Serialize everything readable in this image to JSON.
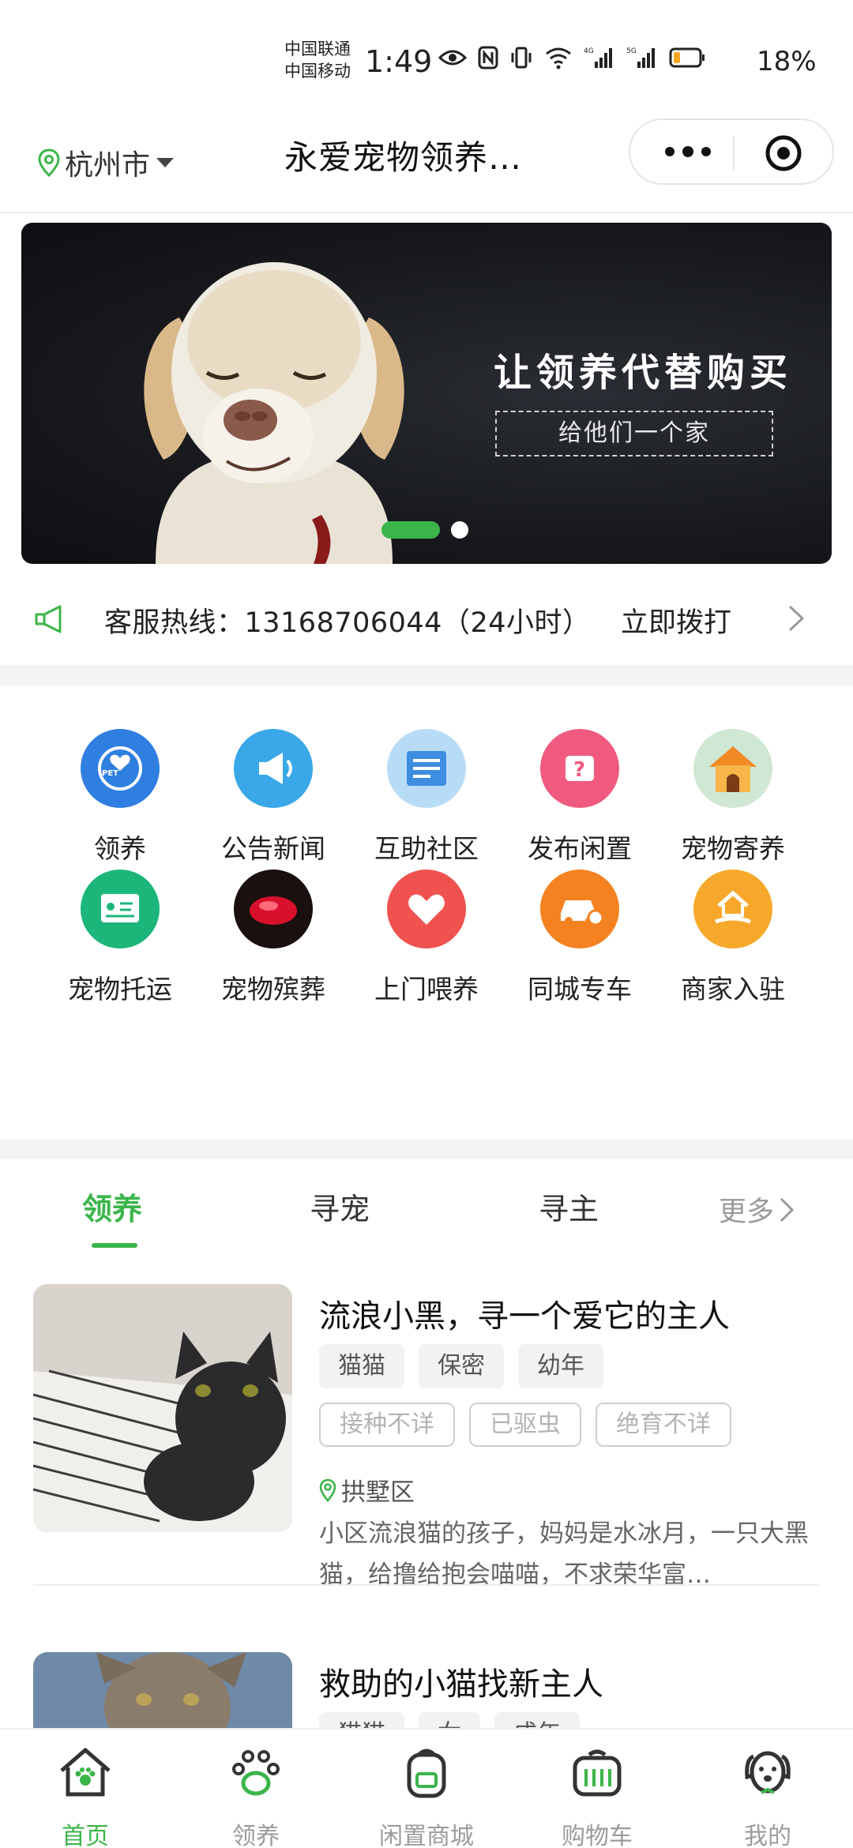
{
  "status_bar": {
    "carrier_1": "中国联通",
    "carrier_2": "中国移动",
    "time": "1:49",
    "battery": "18%"
  },
  "header": {
    "city": "杭州市",
    "title": "永爱宠物领养…"
  },
  "banner": {
    "headline": "让领养代替购买",
    "subline": "给他们一个家",
    "active_slide": 1,
    "slide_count": 2
  },
  "hotline": {
    "text": "客服热线：13168706044（24小时）",
    "action": "立即拨打"
  },
  "menu": {
    "items": [
      {
        "label": "领养",
        "icon": "adopt-pet-icon",
        "color": "#2f7fe0"
      },
      {
        "label": "公告新闻",
        "icon": "megaphone-icon",
        "color": "#3aa7e8"
      },
      {
        "label": "互助社区",
        "icon": "scroll-icon",
        "color": "#5aaeea"
      },
      {
        "label": "发布闲置",
        "icon": "question-box-icon",
        "color": "#f05a7e"
      },
      {
        "label": "宠物寄养",
        "icon": "dog-house-icon",
        "color": "#f7a93a"
      },
      {
        "label": "宠物托运",
        "icon": "pet-id-card-icon",
        "color": "#1cb67a"
      },
      {
        "label": "宠物殡葬",
        "icon": "red-gem-icon",
        "color": "#d8102c"
      },
      {
        "label": "上门喂养",
        "icon": "heart-icon",
        "color": "#f0524f"
      },
      {
        "label": "同城专车",
        "icon": "car-icon",
        "color": "#f58220"
      },
      {
        "label": "商家入驻",
        "icon": "merchant-house-icon",
        "color": "#f7a82b"
      }
    ]
  },
  "tabs": {
    "items": [
      "领养",
      "寻宠",
      "寻主"
    ],
    "more": "更多"
  },
  "listings": [
    {
      "title": "流浪小黑，寻一个爱它的主人",
      "tags": [
        "猫猫",
        "保密",
        "幼年"
      ],
      "health_tags": [
        "接种不详",
        "已驱虫",
        "绝育不详"
      ],
      "location": "拱墅区",
      "description": "小区流浪猫的孩子，妈妈是水冰月，一只大黑猫，给撸给抱会喵喵，不求荣华富…"
    },
    {
      "title": "救助的小猫找新主人",
      "tags": [
        "猫猫",
        "女",
        "成年"
      ]
    }
  ],
  "bottom_nav": {
    "items": [
      {
        "label": "首页",
        "icon": "home-icon"
      },
      {
        "label": "领养",
        "icon": "paw-icon"
      },
      {
        "label": "闲置商城",
        "icon": "backpack-icon"
      },
      {
        "label": "购物车",
        "icon": "pet-carrier-icon"
      },
      {
        "label": "我的",
        "icon": "dog-face-icon"
      }
    ],
    "active_color": "#3bb54a",
    "inactive_color": "#9b9b9b"
  }
}
